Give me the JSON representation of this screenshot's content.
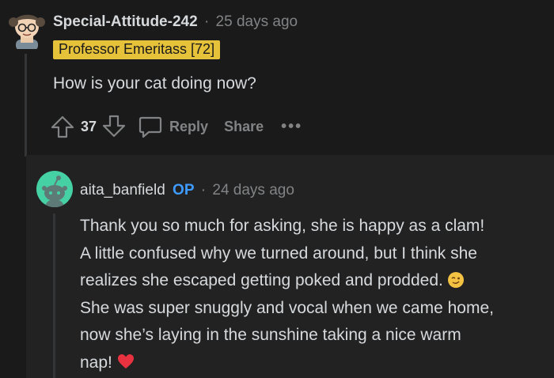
{
  "comment1": {
    "username": "Special-Attitude-242",
    "separator": "·",
    "timestamp": "25 days ago",
    "flair": "Professor Emeritass [72]",
    "body": "How is your cat doing now?",
    "vote_count": "37",
    "reply_label": "Reply",
    "share_label": "Share",
    "more_label": "•••"
  },
  "comment2": {
    "username": "aita_banfield",
    "op_badge": "OP",
    "separator": "·",
    "timestamp": "24 days ago",
    "body_lines": [
      "Thank you so much for asking, she is happy as a clam!",
      "A little confused why we turned around, but I think she",
      "realizes she escaped getting poked and prodded.",
      "She was super snuggly and vocal when we came home,",
      "now she’s laying in the sunshine taking a nice warm",
      "nap!"
    ]
  },
  "colors": {
    "background": "#1a1a1b",
    "nested_background": "#222223",
    "flair_bg": "#e5c23a",
    "op_blue": "#3e9bff",
    "avatar2_bg": "#46d1a4"
  },
  "icons": [
    "user-avatar-icon",
    "upvote-icon",
    "downvote-icon",
    "comment-icon",
    "more-icon",
    "wink-emoji-icon",
    "heart-emoji-icon"
  ]
}
